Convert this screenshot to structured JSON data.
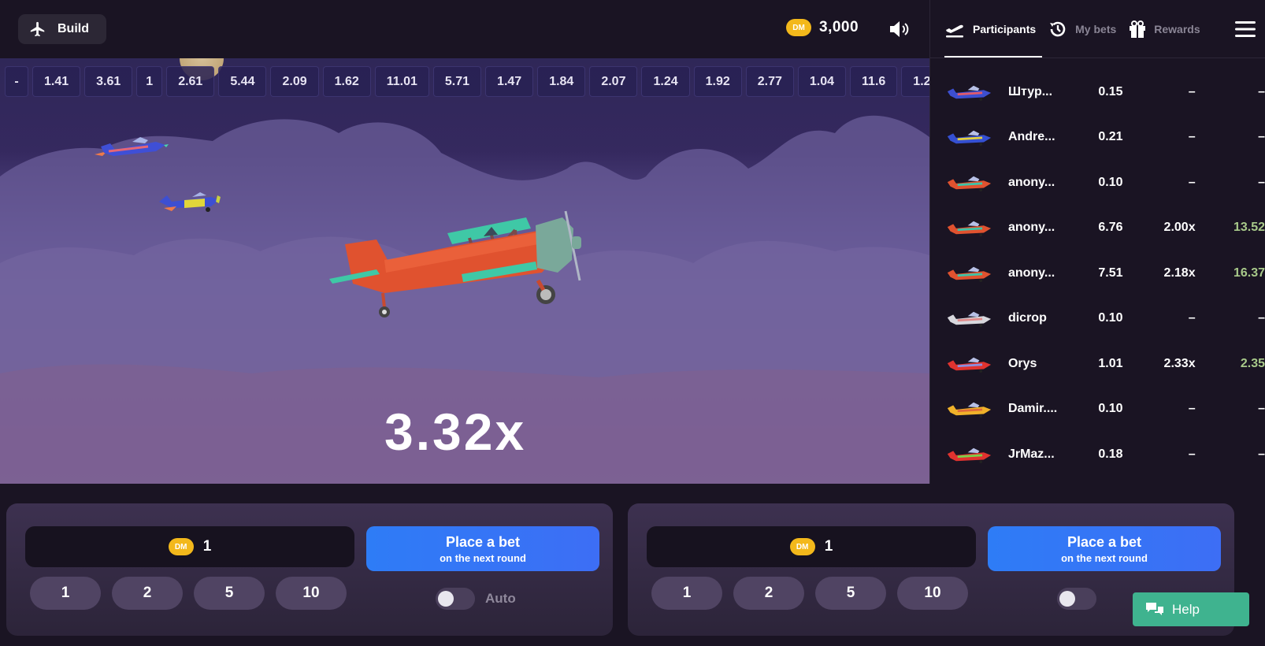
{
  "header": {
    "build_label": "Build",
    "currency_badge": "DM",
    "balance": "3,000"
  },
  "history": [
    "-",
    "1.41",
    "3.61",
    "1",
    "2.61",
    "5.44",
    "2.09",
    "1.62",
    "11.01",
    "5.71",
    "1.47",
    "1.84",
    "2.07",
    "1.24",
    "1.92",
    "2.77",
    "1.04",
    "11.6",
    "1.2"
  ],
  "game": {
    "multiplier": "3.32x"
  },
  "sidebar": {
    "tabs": [
      {
        "label": "Participants",
        "icon": "plane-departure-icon",
        "active": true
      },
      {
        "label": "My bets",
        "icon": "history-icon",
        "active": false
      },
      {
        "label": "Rewards",
        "icon": "gift-icon",
        "active": false
      }
    ],
    "participants": [
      {
        "name": "Штур...",
        "bet": "0.15",
        "mult": "–",
        "win": "–",
        "won": false,
        "plane": "#3d4fd0",
        "accent": "#e05a6a"
      },
      {
        "name": "Andre...",
        "bet": "0.21",
        "mult": "–",
        "win": "–",
        "won": false,
        "plane": "#3550d2",
        "accent": "#e6d23a"
      },
      {
        "name": "anony...",
        "bet": "0.10",
        "mult": "–",
        "win": "–",
        "won": false,
        "plane": "#e0522f",
        "accent": "#3cc4a8"
      },
      {
        "name": "anony...",
        "bet": "6.76",
        "mult": "2.00x",
        "win": "13.52",
        "won": true,
        "plane": "#e0522f",
        "accent": "#3cc4a8"
      },
      {
        "name": "anony...",
        "bet": "7.51",
        "mult": "2.18x",
        "win": "16.37",
        "won": true,
        "plane": "#e0522f",
        "accent": "#3cc4a8"
      },
      {
        "name": "dicrop",
        "bet": "0.10",
        "mult": "–",
        "win": "–",
        "won": false,
        "plane": "#d8d8de",
        "accent": "#e08a8a"
      },
      {
        "name": "Orys",
        "bet": "1.01",
        "mult": "2.33x",
        "win": "2.35",
        "won": true,
        "plane": "#e0332f",
        "accent": "#8a8fe0"
      },
      {
        "name": "Damir....",
        "bet": "0.10",
        "mult": "–",
        "win": "–",
        "won": false,
        "plane": "#f0b22a",
        "accent": "#e06a3a"
      },
      {
        "name": "JrMaz...",
        "bet": "0.18",
        "mult": "–",
        "win": "–",
        "won": false,
        "plane": "#e0332f",
        "accent": "#7ad04a"
      }
    ]
  },
  "bet_panels": [
    {
      "currency_badge": "DM",
      "amount": "1",
      "chips": [
        "1",
        "2",
        "5",
        "10"
      ],
      "button_line1": "Place a bet",
      "button_line2": "on the next round",
      "auto_label": "Auto",
      "auto_on": false
    },
    {
      "currency_badge": "DM",
      "amount": "1",
      "chips": [
        "1",
        "2",
        "5",
        "10"
      ],
      "button_line1": "Place a bet",
      "button_line2": "on the next round",
      "auto_on": false
    }
  ],
  "help_label": "Help",
  "colors": {
    "accent_blue": "#2e7cf6",
    "coin": "#f3b81b",
    "win_green": "#a8c98a",
    "help_green": "#3fb38f"
  }
}
